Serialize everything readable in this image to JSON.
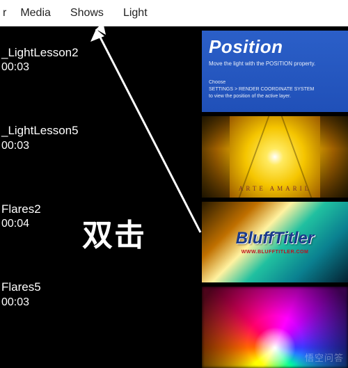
{
  "menu": {
    "item_cut": "r",
    "items": [
      "Media",
      "Shows",
      "Light"
    ]
  },
  "list": [
    {
      "name": "_LightLesson2",
      "duration": "00:03"
    },
    {
      "name": "_LightLesson5",
      "duration": "00:03"
    },
    {
      "name": "Flares2",
      "duration": "00:04"
    },
    {
      "name": "Flares5",
      "duration": "00:03"
    }
  ],
  "thumbs": {
    "t1": {
      "title": "Position",
      "sub": "Move the light with the POSITION property.",
      "small1": "Choose",
      "small2": "SETTINGS > RENDER COORDINATE SYSTEM",
      "small3": "to view the position of the active layer."
    },
    "t2": {
      "caption": "ARTE AMARIL"
    },
    "t3": {
      "logo": "BluffTitler",
      "url": "WWW.BLUFFTITLER.COM"
    }
  },
  "overlay": {
    "double_click": "双击",
    "watermark": "悟空问答"
  }
}
